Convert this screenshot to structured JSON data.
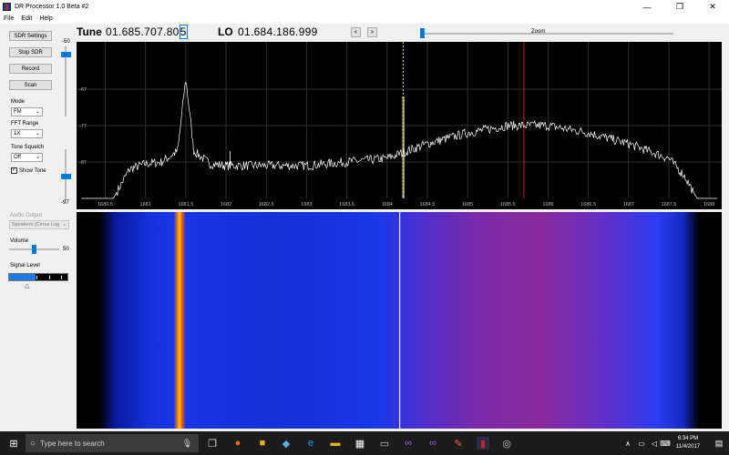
{
  "window": {
    "title": "DR Processor 1.0 Beta #2",
    "controls": [
      "—",
      "❐",
      "✕"
    ]
  },
  "menu": [
    "File",
    "Edit",
    "Help"
  ],
  "left": {
    "buttons": {
      "sdr_settings": "SDR Settings",
      "stop_sdr": "Stop SDR",
      "record": "Record",
      "scan": "Scan"
    },
    "gain_slider": {
      "top": "-50",
      "bottom": "-97"
    },
    "mode": {
      "label": "Mode",
      "value": "FM"
    },
    "fft_range": {
      "label": "FFT Range",
      "value": "1X"
    },
    "tone_squelch": {
      "label": "Tone Squelch",
      "value": "Off"
    },
    "show_tone": {
      "label": "Show Tone",
      "checked": "✓"
    },
    "audio_output": {
      "label": "Audio Output",
      "value": "Speakers (Cirrus Log"
    },
    "volume": {
      "label": "Volume",
      "value": "50"
    },
    "signal_level": {
      "label": "Signal Level",
      "fill_fraction": 0.45,
      "marker": "△"
    }
  },
  "tuning": {
    "tune_label": "Tune",
    "tune_value_main": "01.685.707.80",
    "tune_value_cursor": "5",
    "lo_label": "LO",
    "lo_value": "01.684.186.999",
    "prev": "<",
    "next": ">",
    "zoom_label": "Zoom"
  },
  "chart_data": {
    "type": "line",
    "title": "",
    "xlabel": "",
    "ylabel": "",
    "x_ticks": [
      "1680.5",
      "1681",
      "1681.5",
      "1682",
      "1682.5",
      "1683",
      "1683.5",
      "1684",
      "1684.5",
      "1685",
      "1685.5",
      "1686",
      "1686.5",
      "1687",
      "1687.5",
      "1688"
    ],
    "y_ticks": [
      "-67",
      "-77",
      "-87"
    ],
    "xlim": [
      1680.2,
      1688.1
    ],
    "ylim": [
      -97,
      -55
    ],
    "markers": {
      "lo_line": 1684.2,
      "tune_line": 1685.7
    },
    "series": [
      {
        "x": [
          1680.2,
          1680.6,
          1680.8,
          1681.0,
          1681.2,
          1681.4,
          1681.5,
          1681.6,
          1681.8,
          1682.0,
          1682.5,
          1683.0,
          1683.5,
          1684.0,
          1684.5,
          1685.0,
          1685.5,
          1686.0,
          1686.5,
          1687.0,
          1687.5,
          1687.7,
          1687.85,
          1688.1
        ],
        "values": [
          -97,
          -97,
          -89,
          -87.5,
          -87,
          -84,
          -64,
          -84,
          -87.5,
          -88,
          -88,
          -88,
          -87,
          -86,
          -82,
          -79,
          -77,
          -77,
          -79,
          -82,
          -86,
          -91,
          -97,
          -97
        ]
      }
    ]
  },
  "waterfall": {
    "signal_col_fraction": 0.16,
    "lo_col_fraction": 0.5
  },
  "taskbar": {
    "search_placeholder": "Type here to search",
    "time": "6:34 PM",
    "date": "11/4/2017"
  },
  "colors": {
    "accent": "#0078d7",
    "trace": "#ffffff",
    "tune_line": "#c81e1e",
    "lo_line": "#e0d890",
    "grid": "#2f2f2f"
  }
}
